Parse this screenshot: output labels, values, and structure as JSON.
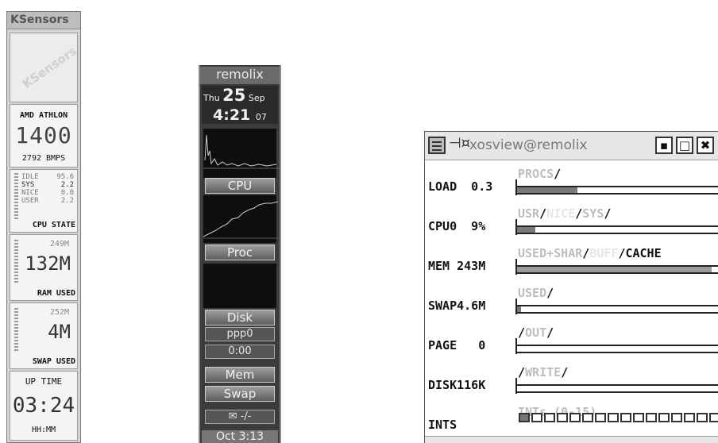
{
  "ksensors": {
    "title": "KSensors",
    "logo_text": "KSensors",
    "cpu_model": "AMD ATHLON",
    "cpu_mhz": "1400",
    "bogomips": "2792 BMPS",
    "cpu_state": {
      "rows": [
        {
          "name": "IDLE",
          "value": "95.6"
        },
        {
          "name": "SYS",
          "value": "2.2"
        },
        {
          "name": "NICE",
          "value": "0.0"
        },
        {
          "name": "USER",
          "value": "2.2"
        }
      ],
      "label": "CPU STATE"
    },
    "ram": {
      "total": "249M",
      "used": "132M",
      "label": "RAM USED"
    },
    "swap": {
      "total": "252M",
      "used": "4M",
      "label": "SWAP USED"
    },
    "uptime": {
      "label": "UP TIME",
      "value": "03:24",
      "format": "HH:MM"
    }
  },
  "dock": {
    "hostname": "remolix",
    "day": "Thu",
    "date_num": "25",
    "month": "Sep",
    "time": "4:21",
    "time_seconds": "07",
    "buttons": {
      "cpu": "CPU",
      "proc": "Proc",
      "disk": "Disk",
      "ppp": "ppp0",
      "timer": "0:00",
      "mem": "Mem",
      "swap": "Swap",
      "mail": "-/-"
    },
    "bottom": "Oct 3:13"
  },
  "xosview": {
    "title": "xosview@remolix",
    "window_buttons": {
      "minimize": "▪",
      "maximize": "□",
      "close": "✖"
    },
    "rows": [
      {
        "label": "LOAD  0.3",
        "legend": [
          {
            "t": "PROCS",
            "c": "d"
          },
          {
            "t": "/",
            "c": "s"
          }
        ],
        "fill": 0.3,
        "color": "#7a7a7a"
      },
      {
        "label": "CPU0  9%",
        "legend": [
          {
            "t": "USR",
            "c": "d"
          },
          {
            "t": "/",
            "c": "s"
          },
          {
            "t": "NICE",
            "c": "l"
          },
          {
            "t": "/",
            "c": "s"
          },
          {
            "t": "SYS",
            "c": "d"
          },
          {
            "t": "/",
            "c": "s"
          }
        ],
        "fill": 0.09,
        "color": "#7a7a7a"
      },
      {
        "label": "MEM 243M",
        "legend": [
          {
            "t": "USED+SHAR",
            "c": "d"
          },
          {
            "t": "/",
            "c": "s"
          },
          {
            "t": "BUFF",
            "c": "l"
          },
          {
            "t": "/",
            "c": "s"
          },
          {
            "t": "CACHE",
            "c": "s"
          }
        ],
        "fill": 0.97,
        "color": "#9a9a9a"
      },
      {
        "label": "SWAP4.6M",
        "legend": [
          {
            "t": "USED",
            "c": "d"
          },
          {
            "t": "/",
            "c": "s"
          }
        ],
        "fill": 0.02,
        "color": "#7a7a7a"
      },
      {
        "label": "PAGE   0",
        "legend": [
          {
            "t": "/",
            "c": "s"
          },
          {
            "t": "OUT",
            "c": "d"
          },
          {
            "t": "/",
            "c": "s"
          }
        ],
        "fill": 0.0,
        "color": "#7a7a7a"
      },
      {
        "label": "DISK116K",
        "legend": [
          {
            "t": "/",
            "c": "s"
          },
          {
            "t": "WRITE",
            "c": "d"
          },
          {
            "t": "/",
            "c": "s"
          }
        ],
        "fill": 0.0,
        "color": "#7a7a7a"
      },
      {
        "label": "INTS",
        "legend": [
          {
            "t": "INTs (0-15)",
            "c": "d"
          }
        ],
        "fill": 0.0,
        "color": "#7a7a7a"
      }
    ],
    "ints_active": [
      true,
      false,
      false,
      false,
      false,
      false,
      false,
      false,
      false,
      false,
      false,
      false,
      false,
      false,
      false,
      false
    ]
  }
}
